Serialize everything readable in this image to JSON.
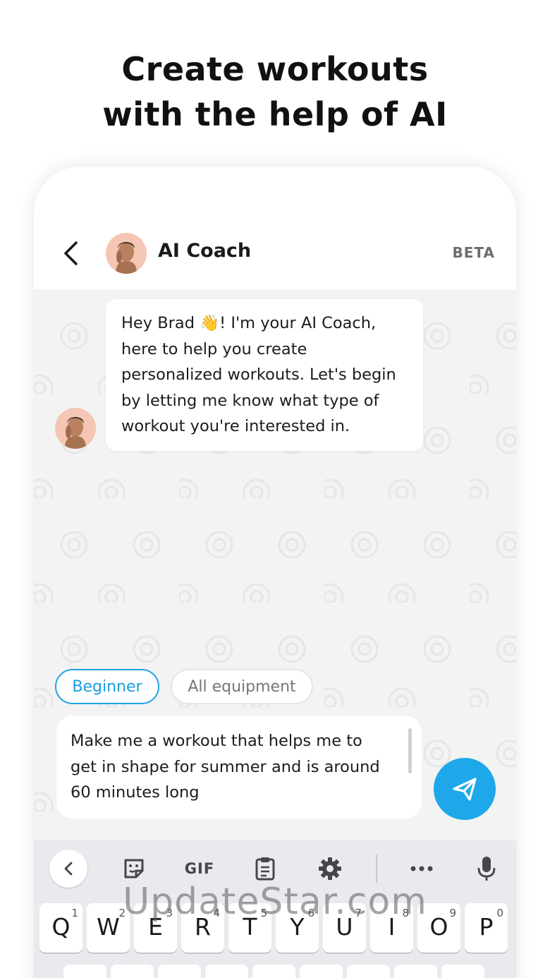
{
  "headline": {
    "line1": "Create workouts",
    "line2": "with the help of AI"
  },
  "header": {
    "title": "AI Coach",
    "badge": "BETA",
    "back_icon": "chevron-left-icon"
  },
  "chat": {
    "message_line1": "Hey Brad 👋! I'm your AI Coach,",
    "message_line2": "here to help you create",
    "message_line3": "personalized workouts. Let's begin",
    "message_line4": "by letting me know what type of",
    "message_line5": "workout you're interested in."
  },
  "chips": [
    {
      "label": "Beginner",
      "selected": true
    },
    {
      "label": "All equipment",
      "selected": false
    }
  ],
  "composer": {
    "line1": "Make me a workout that helps me to",
    "line2": "get in shape for summer and is around",
    "line3": "60 minutes long",
    "send_icon": "paper-plane-icon",
    "accent": "#1ea8ea"
  },
  "keyboard": {
    "toolbar": {
      "collapse_icon": "chevron-left-icon",
      "sticker_icon": "sticker-icon",
      "gif_label": "GIF",
      "clipboard_icon": "clipboard-icon",
      "settings_icon": "gear-icon",
      "more_icon": "more-icon",
      "mic_icon": "microphone-icon"
    },
    "row1": [
      {
        "letter": "Q",
        "num": "1"
      },
      {
        "letter": "W",
        "num": "2"
      },
      {
        "letter": "E",
        "num": "3"
      },
      {
        "letter": "R",
        "num": "4"
      },
      {
        "letter": "T",
        "num": "5"
      },
      {
        "letter": "Y",
        "num": "6"
      },
      {
        "letter": "U",
        "num": "7"
      },
      {
        "letter": "I",
        "num": "8"
      },
      {
        "letter": "O",
        "num": "9"
      },
      {
        "letter": "P",
        "num": "0"
      }
    ]
  },
  "watermark": "UpdateStar.com"
}
